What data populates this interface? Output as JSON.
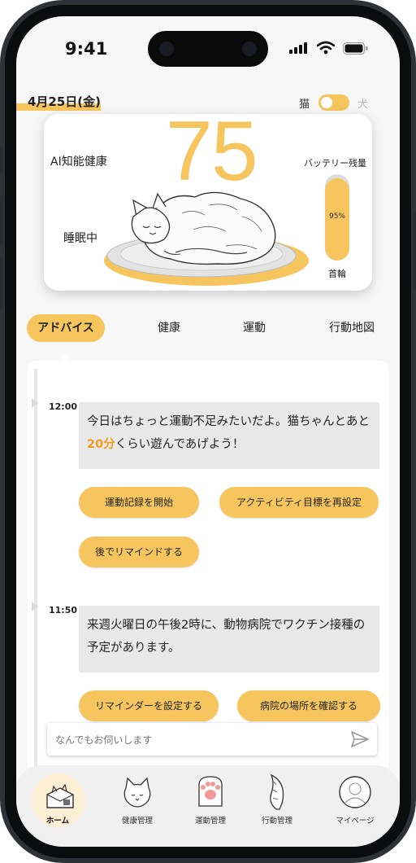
{
  "status_bar": {
    "time": "9:41"
  },
  "header": {
    "date": "4月25日(金)",
    "toggle": {
      "left_label": "猫",
      "right_label": "犬",
      "selected": "猫"
    }
  },
  "summary_card": {
    "score": "75",
    "ai_label": "AI知能健康",
    "state_label": "睡眠中",
    "battery_title": "バッテリー残量",
    "battery_percent": "95%",
    "battery_level": 0.95,
    "device_label": "首輪"
  },
  "tabs": [
    {
      "label": "アドバイス",
      "active": true
    },
    {
      "label": "健康",
      "active": false
    },
    {
      "label": "運動",
      "active": false
    },
    {
      "label": "行動地図",
      "active": false
    }
  ],
  "messages": [
    {
      "time": "12:00",
      "text_part1": "今日はちょっと運動不足みたいだよ。猫ちゃんとあと",
      "text_highlight": "20分",
      "text_part2": "くらい遊んであげよう！",
      "actions": [
        "運動記録を開始",
        "アクティビティ目標を再設定",
        "後でリマインドする"
      ]
    },
    {
      "time": "11:50",
      "text": "来週火曜日の午後2時に、動物病院でワクチン接種の予定があります。",
      "actions": [
        "リマインダーを設定する",
        "病院の場所を確認する"
      ]
    }
  ],
  "input": {
    "placeholder": "なんでもお伺いします"
  },
  "bottom_nav": [
    {
      "label": "ホーム",
      "icon": "home-cat-box-icon",
      "active": true
    },
    {
      "label": "健康管理",
      "icon": "cat-face-icon",
      "active": false
    },
    {
      "label": "運動管理",
      "icon": "paw-icon",
      "active": false
    },
    {
      "label": "行動管理",
      "icon": "cat-tail-icon",
      "active": false
    },
    {
      "label": "マイページ",
      "icon": "profile-avatar-icon",
      "active": false
    }
  ],
  "colors": {
    "accent": "#f6c55e",
    "highlight": "#f09a1e",
    "bubble": "#e9e9e9",
    "background": "#f7f7f7"
  }
}
